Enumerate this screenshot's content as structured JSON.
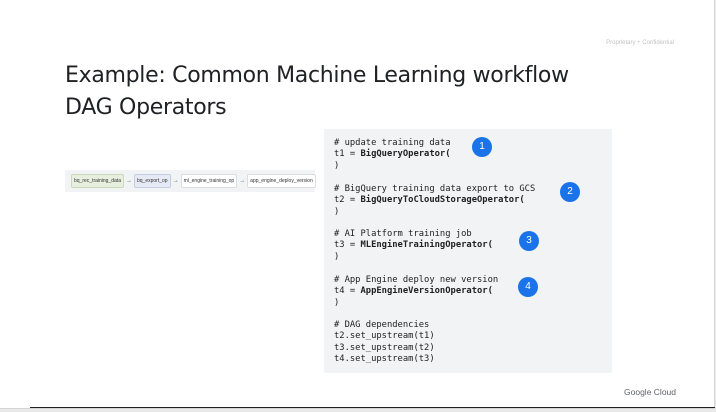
{
  "header": {
    "confidential": "Proprietary + Confidential"
  },
  "title": {
    "line1": "Example: Common Machine Learning workflow",
    "line2": "DAG Operators"
  },
  "dag": {
    "nodes": [
      "bq_rec_training_data",
      "bq_export_op",
      "ml_engine_training_op",
      "app_engine_deploy_version"
    ],
    "arrow": "→"
  },
  "code": {
    "blocks": [
      {
        "comment": "# update training data",
        "assign": "t1 = ",
        "operator": "BigQueryOperator(",
        "close": ")",
        "badge": "1"
      },
      {
        "comment": "# BigQuery training data export to GCS",
        "assign": "t2 = ",
        "operator": "BigQueryToCloudStorageOperator(",
        "close": ")",
        "badge": "2"
      },
      {
        "comment": "# AI Platform training job",
        "assign": "t3 = ",
        "operator": "MLEngineTrainingOperator(",
        "close": ")",
        "badge": "3"
      },
      {
        "comment": "# App Engine deploy new version",
        "assign": "t4 = ",
        "operator": "AppEngineVersionOperator(",
        "close": ")",
        "badge": "4"
      }
    ],
    "dependencies": {
      "comment": "# DAG dependencies",
      "lines": [
        "t2.set_upstream(t1)",
        "t3.set_upstream(t2)",
        "t4.set_upstream(t3)"
      ]
    }
  },
  "footer": {
    "brand": "Google Cloud"
  },
  "colors": {
    "accent": "#1a73e8",
    "code_bg": "#f1f3f4",
    "text": "#202124"
  }
}
